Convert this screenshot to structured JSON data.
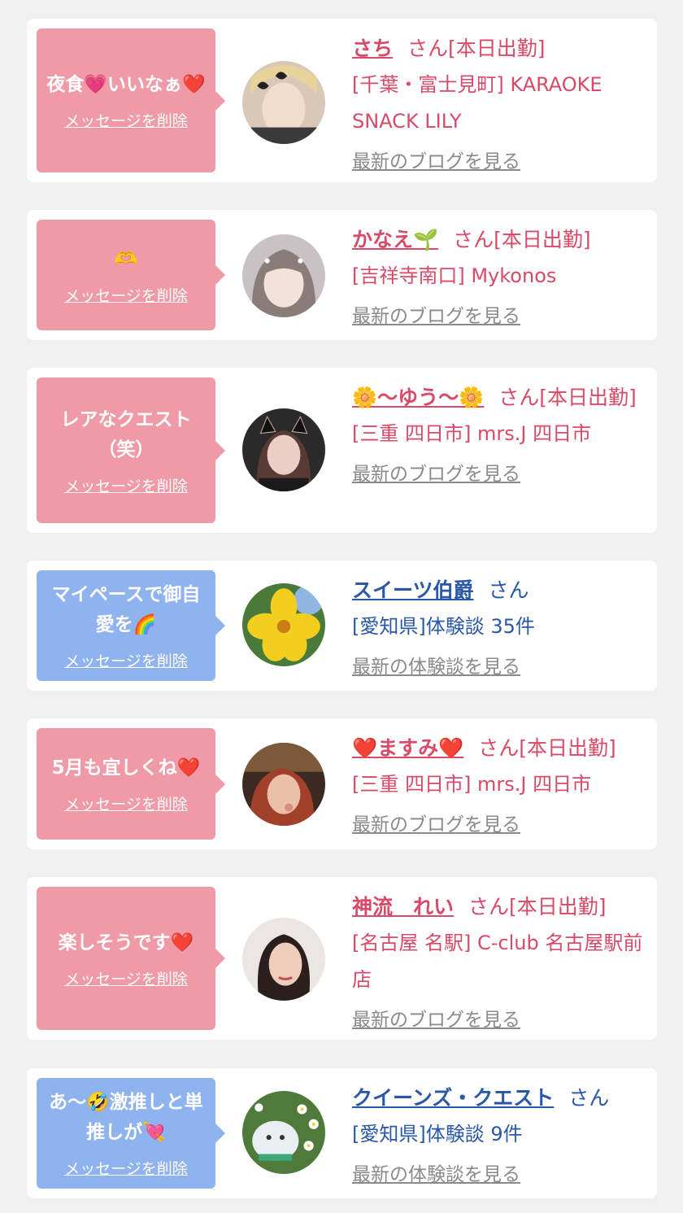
{
  "colors": {
    "page_bg": "#f0f0f0",
    "card_bg": "#ffffff",
    "cast_bubble": "#ef9aa6",
    "user_bubble": "#8fb3ee",
    "cast_text": "#d84a67",
    "user_text": "#2a58a8",
    "link_gray": "#8a8a8a"
  },
  "messages": [
    {
      "kind": "cast",
      "bubble_text": "夜食💗いいなぁ❤️",
      "delete_label": "メッセージを削除",
      "name": "さち",
      "honorific": "さん[本日出勤]",
      "shop": "[千葉・富士見町] KARAOKE SNACK LILY",
      "link_label": "最新のブログを見る",
      "avatar": "woman-blonde-avatar"
    },
    {
      "kind": "cast",
      "bubble_text": "🫶",
      "delete_label": "メッセージを削除",
      "name": "かなえ🌱",
      "honorific": "さん[本日出勤]",
      "shop": "[吉祥寺南口] Mykonos",
      "link_label": "最新のブログを見る",
      "avatar": "woman-light-hair-avatar"
    },
    {
      "kind": "cast",
      "bubble_text": "レアなクエスト（笑）",
      "delete_label": "メッセージを削除",
      "name": "🌼〜ゆう〜🌼",
      "honorific": "さん[本日出勤]",
      "shop": "[三重 四日市] mrs.J 四日市",
      "link_label": "最新のブログを見る",
      "avatar": "woman-cat-ears-avatar"
    },
    {
      "kind": "user",
      "bubble_text": "マイペースで御自愛を🌈",
      "delete_label": "メッセージを削除",
      "name": "スイーツ伯爵",
      "honorific": "さん",
      "shop": "[愛知県]体験談 35件",
      "link_label": "最新の体験談を見る",
      "avatar": "yellow-flower-avatar"
    },
    {
      "kind": "cast",
      "bubble_text": "5月も宜しくね❤️",
      "delete_label": "メッセージを削除",
      "name": "❤️ますみ❤️",
      "honorific": "さん[本日出勤]",
      "shop": "[三重 四日市] mrs.J 四日市",
      "link_label": "最新のブログを見る",
      "avatar": "woman-red-hair-avatar"
    },
    {
      "kind": "cast",
      "bubble_text": "楽しそうです❤️",
      "delete_label": "メッセージを削除",
      "name": "神流　れい",
      "honorific": "さん[本日出勤]",
      "shop": "[名古屋 名駅] C-club 名古屋駅前店",
      "link_label": "最新のブログを見る",
      "avatar": "woman-dark-hair-avatar"
    },
    {
      "kind": "user",
      "bubble_text": "あ〜🤣激推しと単推しが💘",
      "delete_label": "メッセージを削除",
      "name": "クイーンズ・クエスト",
      "honorific": "さん",
      "shop": "[愛知県]体験談 9件",
      "link_label": "最新の体験談を見る",
      "avatar": "mascot-flowers-avatar"
    }
  ]
}
